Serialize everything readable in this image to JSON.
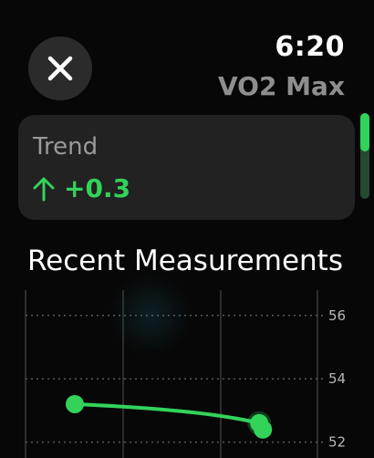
{
  "header": {
    "time": "6:20",
    "title": "VO2 Max",
    "close_icon": "xmark-icon"
  },
  "trend": {
    "label": "Trend",
    "direction_icon": "arrow-up-icon",
    "value": "+0.3",
    "color": "#33d35a"
  },
  "section": {
    "title": "Recent Measurements"
  },
  "chart_data": {
    "type": "line",
    "title": "",
    "xlabel": "",
    "ylabel": "",
    "ylim": [
      51.5,
      56.8
    ],
    "y_ticks": [
      "56",
      "54",
      "52"
    ],
    "grid": true,
    "axis_side": "right",
    "series": [
      {
        "points": [
          {
            "x": 0.0,
            "y": 53.2
          },
          {
            "x": 1.0,
            "y": 52.6
          },
          {
            "x": 1.02,
            "y": 52.4
          }
        ],
        "color": "#33d35a"
      }
    ]
  }
}
